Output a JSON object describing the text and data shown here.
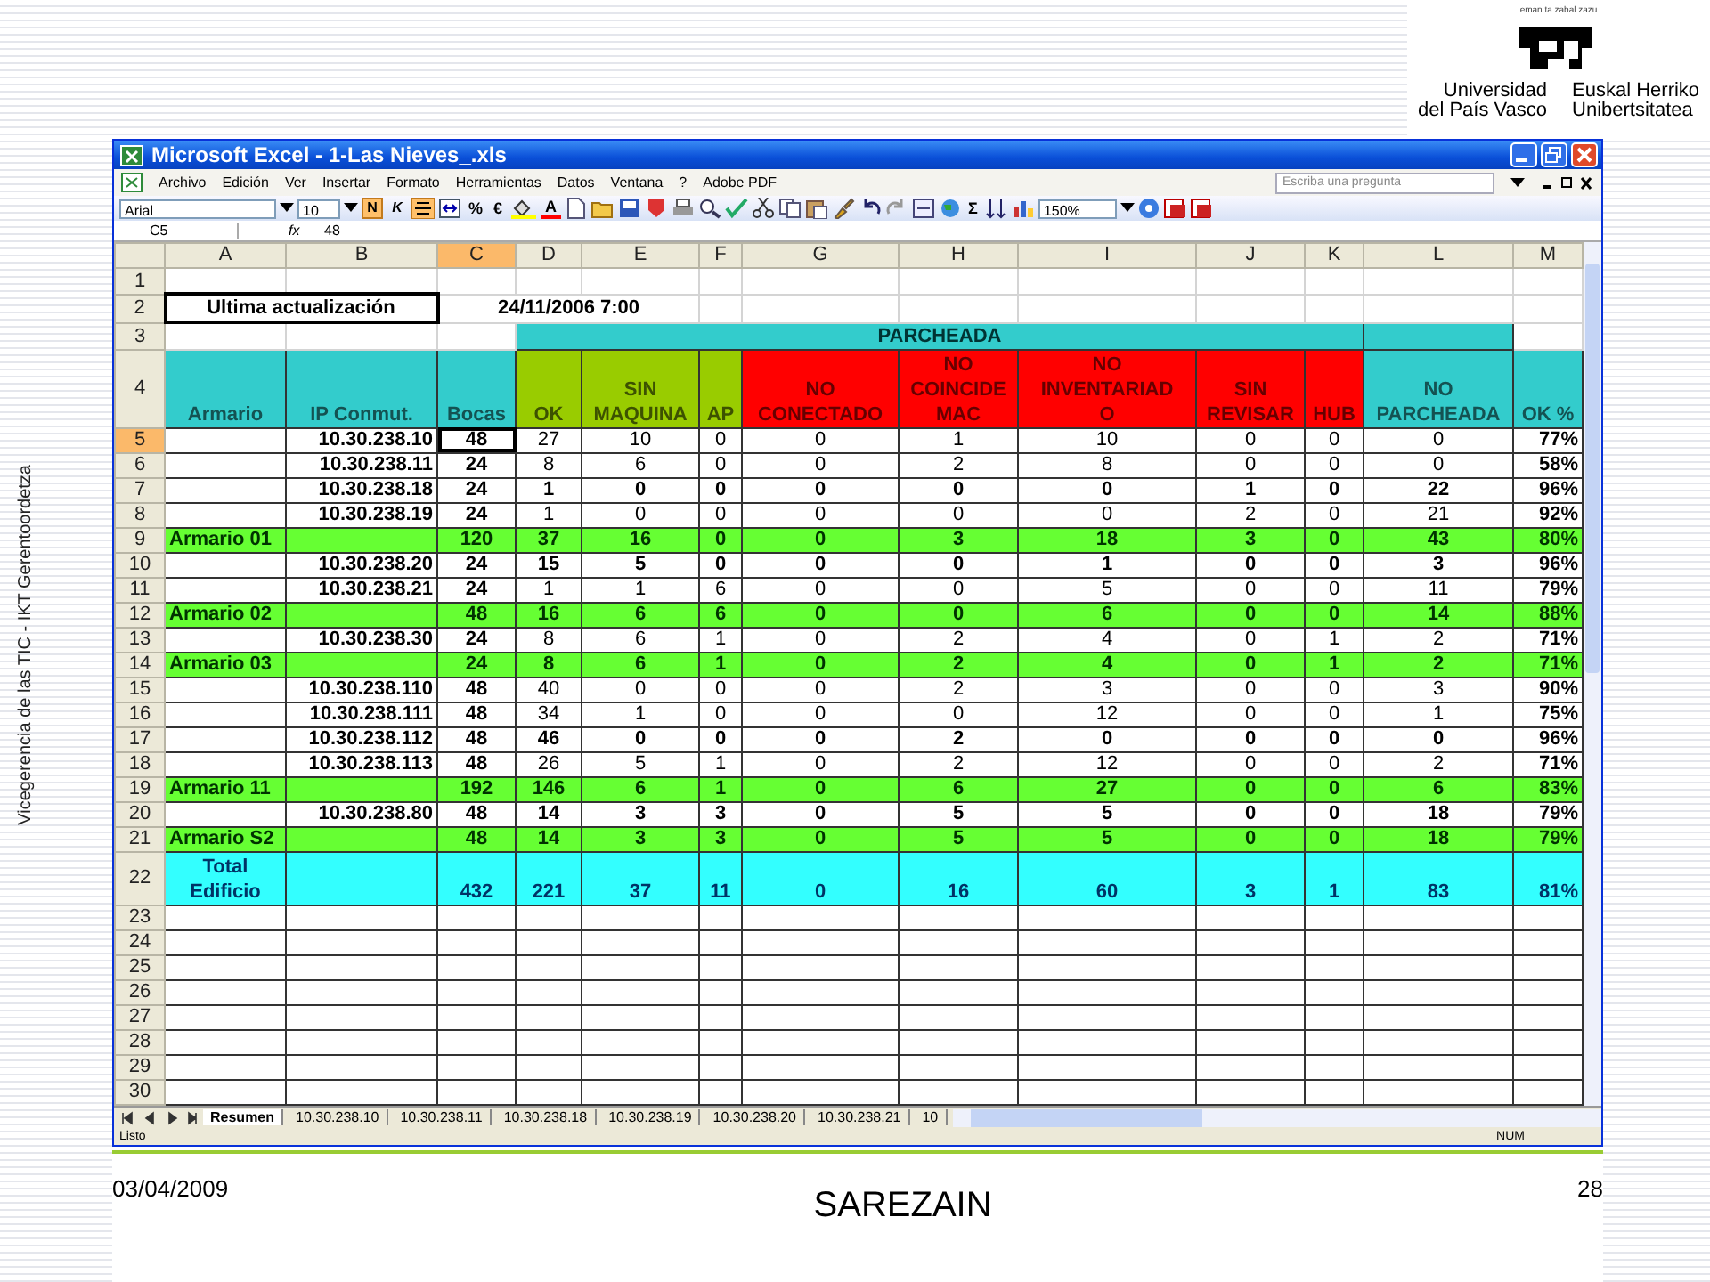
{
  "slide": {
    "side_text": "Vicegerencia de las TIC - IKT Gerentoordetza",
    "logo": {
      "motto": "eman ta zabal zazu",
      "name_es": "Universidad\ndel País Vasco",
      "name_eu": "Euskal Herriko\nUnibertsitatea"
    },
    "footer": {
      "date": "03/04/2009",
      "title": "SAREZAIN",
      "page": "28"
    }
  },
  "window": {
    "title": "Microsoft Excel - 1-Las Nieves_.xls",
    "menu": [
      "Archivo",
      "Edición",
      "Ver",
      "Insertar",
      "Formato",
      "Herramientas",
      "Datos",
      "Ventana",
      "?",
      "Adobe PDF"
    ],
    "ask_placeholder": "Escriba una pregunta",
    "font": "Arial",
    "size": "10",
    "format_buttons": [
      {
        "label": "N",
        "selected": true
      },
      {
        "label": "K",
        "selected": false
      }
    ],
    "percent": "%",
    "euro": "€",
    "font_color": "A",
    "sum": "Σ",
    "zoom": "150%",
    "name_box": "C5",
    "fx": "fx",
    "formula": "48"
  },
  "sheet": {
    "columns": [
      {
        "label": "A",
        "selected": false
      },
      {
        "label": "B",
        "selected": false
      },
      {
        "label": "C",
        "selected": true
      },
      {
        "label": "D",
        "selected": false
      },
      {
        "label": "E",
        "selected": false
      },
      {
        "label": "F",
        "selected": false
      },
      {
        "label": "G",
        "selected": false
      },
      {
        "label": "H",
        "selected": false
      },
      {
        "label": "I",
        "selected": false
      },
      {
        "label": "J",
        "selected": false
      },
      {
        "label": "K",
        "selected": false
      },
      {
        "label": "L",
        "selected": false
      },
      {
        "label": "M",
        "selected": false
      }
    ],
    "rows": [
      {
        "n": "1",
        "kind": "blank",
        "selected": false
      },
      {
        "n": "2",
        "kind": "info",
        "selected": false,
        "label": "Ultima actualización",
        "value": "24/11/2006 7:00"
      },
      {
        "n": "3",
        "kind": "band",
        "selected": false,
        "label": "PARCHEADA"
      },
      {
        "n": "4",
        "kind": "header",
        "selected": false,
        "cells": [
          {
            "text": "Armario",
            "color": "#33cccc"
          },
          {
            "text": "IP Conmut.",
            "color": "#33cccc"
          },
          {
            "text": "Bocas",
            "color": "#33cccc"
          },
          {
            "text": "OK",
            "color": "#99cc00"
          },
          {
            "text": "SIN\nMAQUINA",
            "color": "#99cc00"
          },
          {
            "text": "AP",
            "color": "#99cc00"
          },
          {
            "text": "NO\nCONECTADO",
            "color": "#ff0000"
          },
          {
            "text": "NO\nCOINCIDE\nMAC",
            "color": "#ff0000"
          },
          {
            "text": "NO\nINVENTARIAD\nO",
            "color": "#ff0000"
          },
          {
            "text": "SIN\nREVISAR",
            "color": "#ff0000"
          },
          {
            "text": "HUB",
            "color": "#ff0000"
          },
          {
            "text": "NO\nPARCHEADA",
            "color": "#33cccc"
          },
          {
            "text": "OK %",
            "color": "#33cccc"
          }
        ]
      },
      {
        "n": "5",
        "kind": "detail",
        "selected": true,
        "bold": false,
        "cells": [
          "",
          "10.30.238.10",
          "48",
          "27",
          "10",
          "0",
          "0",
          "1",
          "10",
          "0",
          "0",
          "0",
          "77%"
        ]
      },
      {
        "n": "6",
        "kind": "detail",
        "selected": false,
        "bold": false,
        "cells": [
          "",
          "10.30.238.11",
          "24",
          "8",
          "6",
          "0",
          "0",
          "2",
          "8",
          "0",
          "0",
          "0",
          "58%"
        ]
      },
      {
        "n": "7",
        "kind": "detail",
        "selected": false,
        "bold": true,
        "cells": [
          "",
          "10.30.238.18",
          "24",
          "1",
          "0",
          "0",
          "0",
          "0",
          "0",
          "1",
          "0",
          "22",
          "96%"
        ]
      },
      {
        "n": "8",
        "kind": "detail",
        "selected": false,
        "bold": false,
        "cells": [
          "",
          "10.30.238.19",
          "24",
          "1",
          "0",
          "0",
          "0",
          "0",
          "0",
          "2",
          "0",
          "21",
          "92%"
        ]
      },
      {
        "n": "9",
        "kind": "group",
        "selected": false,
        "cells": [
          "Armario 01",
          "",
          "120",
          "37",
          "16",
          "0",
          "0",
          "3",
          "18",
          "3",
          "0",
          "43",
          "80%"
        ]
      },
      {
        "n": "10",
        "kind": "detail",
        "selected": false,
        "bold": true,
        "cells": [
          "",
          "10.30.238.20",
          "24",
          "15",
          "5",
          "0",
          "0",
          "0",
          "1",
          "0",
          "0",
          "3",
          "96%"
        ]
      },
      {
        "n": "11",
        "kind": "detail",
        "selected": false,
        "bold": false,
        "cells": [
          "",
          "10.30.238.21",
          "24",
          "1",
          "1",
          "6",
          "0",
          "0",
          "5",
          "0",
          "0",
          "11",
          "79%"
        ]
      },
      {
        "n": "12",
        "kind": "group",
        "selected": false,
        "cells": [
          "Armario 02",
          "",
          "48",
          "16",
          "6",
          "6",
          "0",
          "0",
          "6",
          "0",
          "0",
          "14",
          "88%"
        ]
      },
      {
        "n": "13",
        "kind": "detail",
        "selected": false,
        "bold": false,
        "cells": [
          "",
          "10.30.238.30",
          "24",
          "8",
          "6",
          "1",
          "0",
          "2",
          "4",
          "0",
          "1",
          "2",
          "71%"
        ]
      },
      {
        "n": "14",
        "kind": "group",
        "selected": false,
        "cells": [
          "Armario 03",
          "",
          "24",
          "8",
          "6",
          "1",
          "0",
          "2",
          "4",
          "0",
          "1",
          "2",
          "71%"
        ]
      },
      {
        "n": "15",
        "kind": "detail",
        "selected": false,
        "bold": false,
        "cells": [
          "",
          "10.30.238.110",
          "48",
          "40",
          "0",
          "0",
          "0",
          "2",
          "3",
          "0",
          "0",
          "3",
          "90%"
        ]
      },
      {
        "n": "16",
        "kind": "detail",
        "selected": false,
        "bold": false,
        "cells": [
          "",
          "10.30.238.111",
          "48",
          "34",
          "1",
          "0",
          "0",
          "0",
          "12",
          "0",
          "0",
          "1",
          "75%"
        ]
      },
      {
        "n": "17",
        "kind": "detail",
        "selected": false,
        "bold": true,
        "cells": [
          "",
          "10.30.238.112",
          "48",
          "46",
          "0",
          "0",
          "0",
          "2",
          "0",
          "0",
          "0",
          "0",
          "96%"
        ]
      },
      {
        "n": "18",
        "kind": "detail",
        "selected": false,
        "bold": false,
        "cells": [
          "",
          "10.30.238.113",
          "48",
          "26",
          "5",
          "1",
          "0",
          "2",
          "12",
          "0",
          "0",
          "2",
          "71%"
        ]
      },
      {
        "n": "19",
        "kind": "group",
        "selected": false,
        "cells": [
          "Armario 11",
          "",
          "192",
          "146",
          "6",
          "1",
          "0",
          "6",
          "27",
          "0",
          "0",
          "6",
          "83%"
        ]
      },
      {
        "n": "20",
        "kind": "detail",
        "selected": false,
        "bold": true,
        "cells": [
          "",
          "10.30.238.80",
          "48",
          "14",
          "3",
          "3",
          "0",
          "5",
          "5",
          "0",
          "0",
          "18",
          "79%"
        ]
      },
      {
        "n": "21",
        "kind": "group",
        "selected": false,
        "cells": [
          "Armario S2",
          "",
          "48",
          "14",
          "3",
          "3",
          "0",
          "5",
          "5",
          "0",
          "0",
          "18",
          "79%"
        ]
      },
      {
        "n": "22",
        "kind": "total",
        "selected": false,
        "cells": [
          "Total\nEdificio",
          "",
          "432",
          "221",
          "37",
          "11",
          "0",
          "16",
          "60",
          "3",
          "1",
          "83",
          "81%"
        ]
      },
      {
        "n": "23",
        "kind": "empty",
        "selected": false
      },
      {
        "n": "24",
        "kind": "empty",
        "selected": false
      },
      {
        "n": "25",
        "kind": "empty",
        "selected": false
      },
      {
        "n": "26",
        "kind": "empty",
        "selected": false
      },
      {
        "n": "27",
        "kind": "empty",
        "selected": false
      },
      {
        "n": "28",
        "kind": "empty",
        "selected": false
      },
      {
        "n": "29",
        "kind": "empty",
        "selected": false
      },
      {
        "n": "30",
        "kind": "empty",
        "selected": false
      }
    ]
  },
  "sheet_tabs": [
    {
      "label": "Resumen",
      "selected": true
    },
    {
      "label": "10.30.238.10",
      "selected": false
    },
    {
      "label": "10.30.238.11",
      "selected": false
    },
    {
      "label": "10.30.238.18",
      "selected": false
    },
    {
      "label": "10.30.238.19",
      "selected": false
    },
    {
      "label": "10.30.238.20",
      "selected": false
    },
    {
      "label": "10.30.238.21",
      "selected": false
    },
    {
      "label": "10",
      "selected": false
    }
  ],
  "status_bar": {
    "left": "Listo",
    "num": "NUM"
  }
}
